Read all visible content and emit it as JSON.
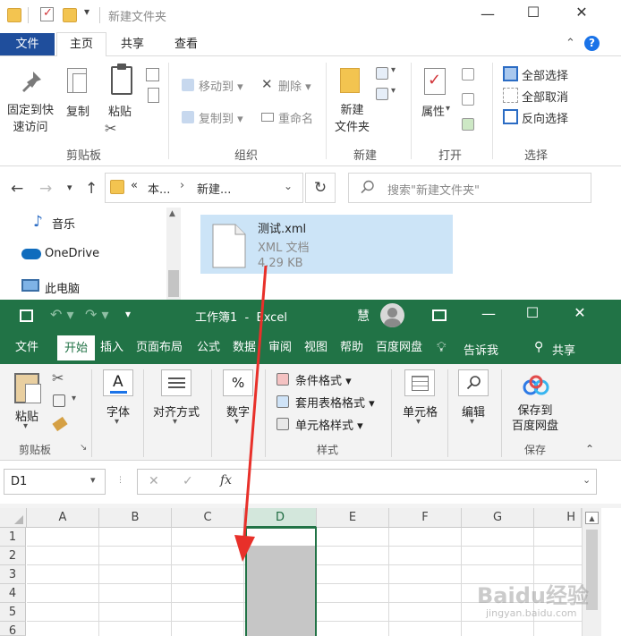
{
  "explorer": {
    "title": "新建文件夹",
    "tabs": [
      "文件",
      "主页",
      "共享",
      "查看"
    ],
    "ribbon": {
      "pin_label": "固定到快\n速访问",
      "copy_label": "复制",
      "paste_label": "粘贴",
      "clipboard_group": "剪贴板",
      "move_to": "移动到",
      "copy_to": "复制到",
      "delete": "删除",
      "rename": "重命名",
      "organize_group": "组织",
      "new_folder": "新建\n文件夹",
      "new_group": "新建",
      "properties": "属性",
      "open_group": "打开",
      "select_all": "全部选择",
      "select_none": "全部取消",
      "invert_selection": "反向选择",
      "select_group": "选择"
    },
    "address": {
      "part1": "本...",
      "part2": "新建..."
    },
    "search_placeholder": "搜索\"新建文件夹\"",
    "nav": [
      {
        "label": "音乐",
        "icon": "music-icon"
      },
      {
        "label": "OneDrive",
        "icon": "cloud-icon"
      },
      {
        "label": "此电脑",
        "icon": "computer-icon"
      }
    ],
    "file": {
      "name": "测试.xml",
      "type": "XML 文档",
      "size": "4.29 KB"
    }
  },
  "excel": {
    "title": "工作簿1  -  Excel",
    "user_initial": "慧",
    "tabs": [
      "文件",
      "开始",
      "插入",
      "页面布局",
      "公式",
      "数据",
      "审阅",
      "视图",
      "帮助",
      "百度网盘"
    ],
    "tell_me": "告诉我",
    "share": "共享",
    "ribbon": {
      "paste": "粘贴",
      "clipboard_group": "剪贴板",
      "font": "字体",
      "alignment": "对齐方式",
      "number": "数字",
      "conditional_format": "条件格式",
      "table_format": "套用表格格式",
      "cell_style": "单元格样式",
      "styles_group": "样式",
      "cells": "单元格",
      "editing": "编辑",
      "save_to_baidu": "保存到\n百度网盘",
      "save_group": "保存"
    },
    "name_box": "D1",
    "fx": "fx",
    "columns": [
      "A",
      "B",
      "C",
      "D",
      "E",
      "F",
      "G",
      "H"
    ],
    "rows": [
      "1",
      "2",
      "3",
      "4",
      "5",
      "6"
    ]
  },
  "watermark": {
    "text": "Baidu经验",
    "sub": "jingyan.baidu.com"
  },
  "colors": {
    "excel_green": "#217346",
    "explorer_file_tab": "#1f4e9c",
    "selection": "#cce4f7",
    "arrow": "#e8302a"
  }
}
